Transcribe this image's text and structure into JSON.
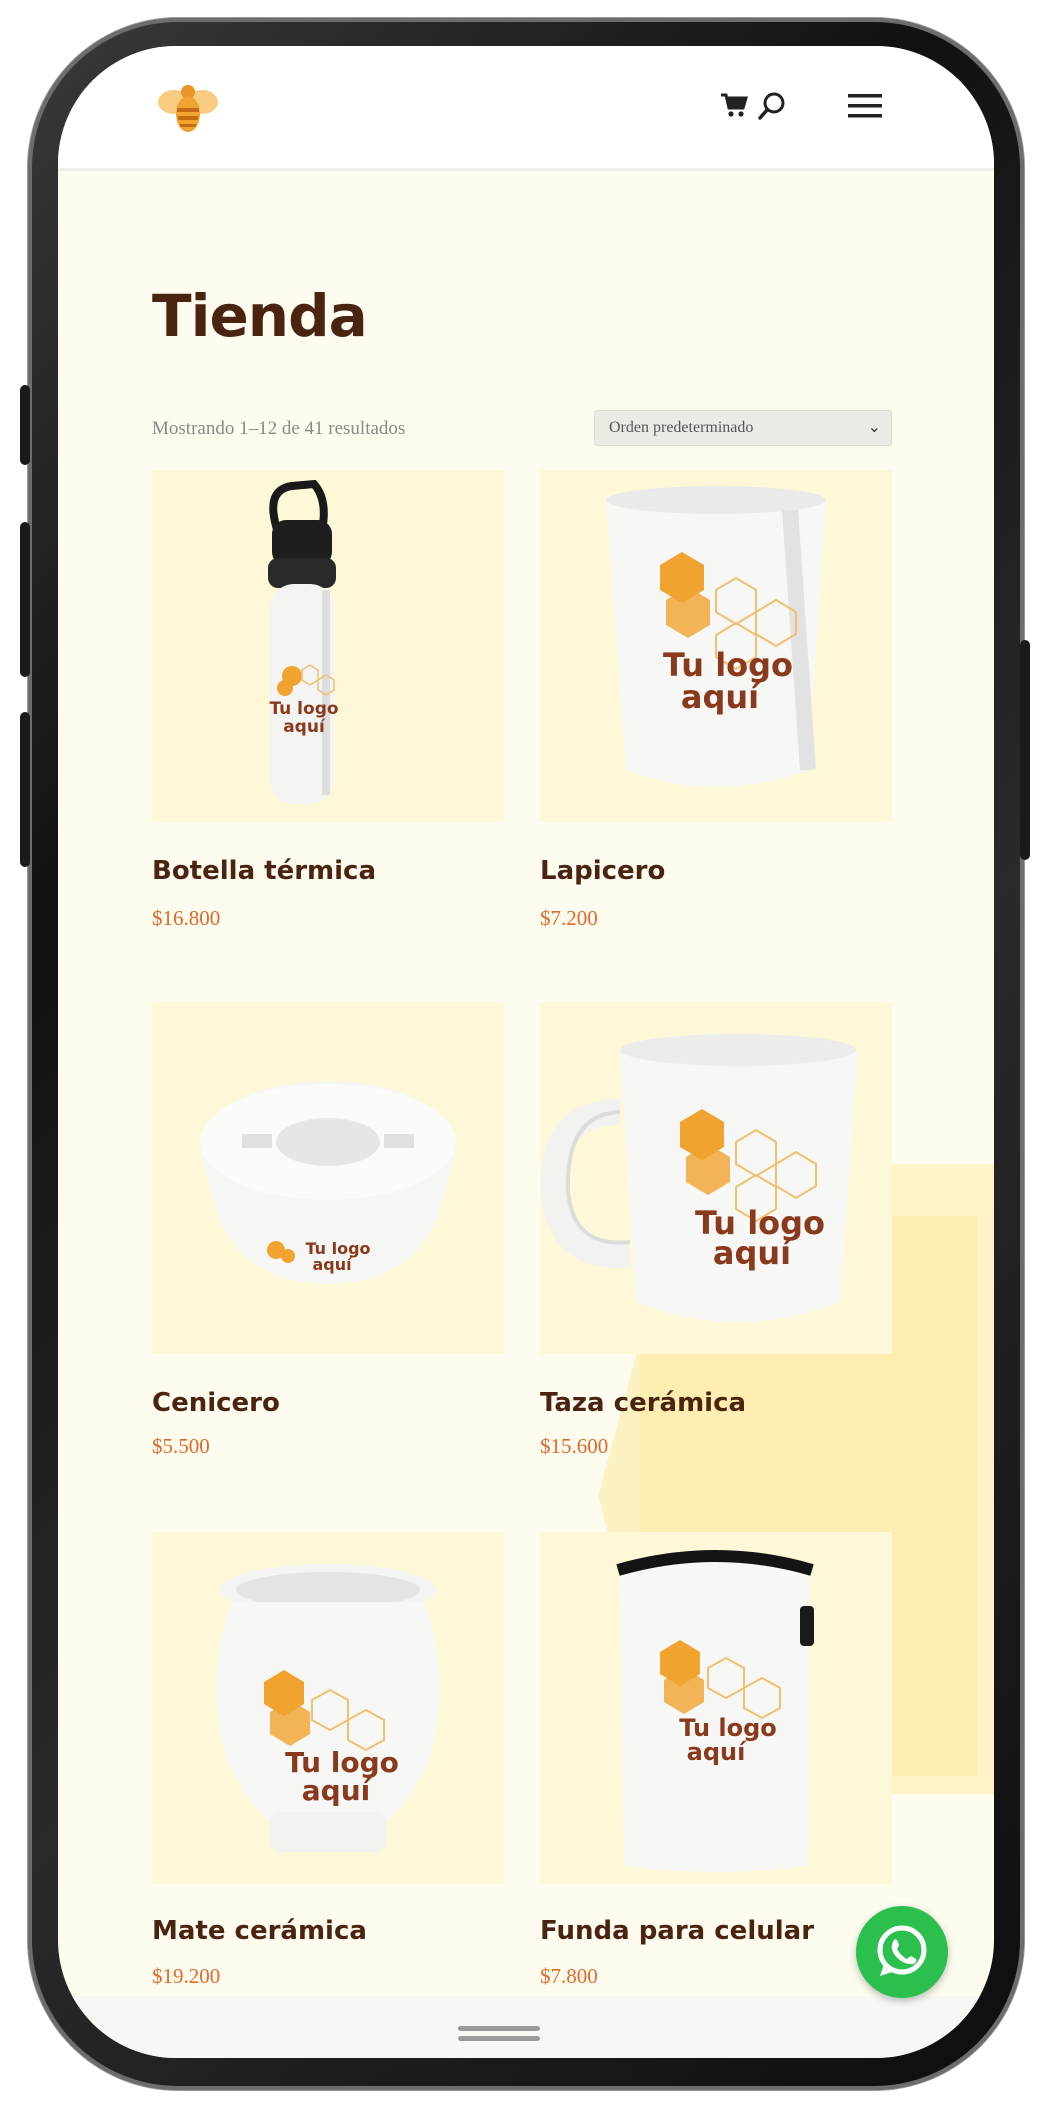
{
  "page": {
    "title": "Tienda"
  },
  "header": {
    "logo": "bee-logo",
    "icons": [
      "cart-icon",
      "search-icon",
      "menu-icon"
    ]
  },
  "shop": {
    "result_count": "Mostrando 1–12 de 41 resultados",
    "sort_selected": "Orden predeterminado"
  },
  "products": [
    {
      "name": "Botella térmica",
      "price": "$16.800",
      "image_text": [
        "Tu logo",
        "aquí"
      ]
    },
    {
      "name": "Lapicero",
      "price": "$7.200",
      "image_text": [
        "Tu logo",
        "aquí"
      ]
    },
    {
      "name": "Cenicero",
      "price": "$5.500",
      "image_text": [
        "Tu logo",
        "aquí"
      ]
    },
    {
      "name": "Taza cerámica",
      "price": "$15.600",
      "image_text": [
        "Tu logo",
        "aquí"
      ]
    },
    {
      "name": "Mate cerámica",
      "price": "$19.200",
      "image_text": [
        "Tu logo",
        "aquí"
      ]
    },
    {
      "name": "Funda para celular",
      "price": "$7.800",
      "image_text": [
        "Tu logo",
        "aquí"
      ]
    }
  ],
  "floating": {
    "whatsapp": "whatsapp-icon"
  },
  "colors": {
    "brand_brown": "#4a2410",
    "price_orange": "#e06a2a",
    "whatsapp_green": "#2bbf4e",
    "bee_orange": "#f0a32e"
  }
}
